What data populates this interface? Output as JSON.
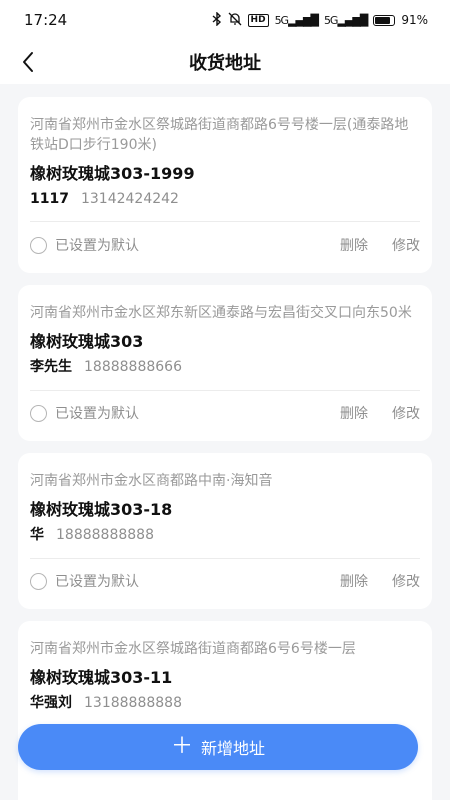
{
  "status_bar": {
    "time": "17:24",
    "network_hd": "HD",
    "signal_1": "5G",
    "signal_2": "5G",
    "battery": "91"
  },
  "header": {
    "title": "收货地址"
  },
  "addresses": [
    {
      "full": "河南省郑州市金水区祭城路街道商都路6号号楼一层(通泰路地铁站D口步行190米)",
      "detail": "橡树玫瑰城303-1999",
      "name": "1117",
      "phone": "13142424242",
      "default_label": "已设置为默认",
      "delete_label": "删除",
      "edit_label": "修改"
    },
    {
      "full": "河南省郑州市金水区郑东新区通泰路与宏昌街交叉口向东50米",
      "detail": "橡树玫瑰城303",
      "name": "李先生",
      "phone": "18888888666",
      "default_label": "已设置为默认",
      "delete_label": "删除",
      "edit_label": "修改"
    },
    {
      "full": "河南省郑州市金水区商都路中南·海知音",
      "detail": "橡树玫瑰城303-18",
      "name": "华",
      "phone": "18888888888",
      "default_label": "已设置为默认",
      "delete_label": "删除",
      "edit_label": "修改"
    },
    {
      "full": "河南省郑州市金水区祭城路街道商都路6号6号楼一层",
      "detail": "橡树玫瑰城303-11",
      "name": "华强刘",
      "phone": "13188888888"
    }
  ],
  "footer": {
    "add_label": "新增地址"
  },
  "colors": {
    "accent": "#4a8af7",
    "background": "#f5f6f8"
  }
}
